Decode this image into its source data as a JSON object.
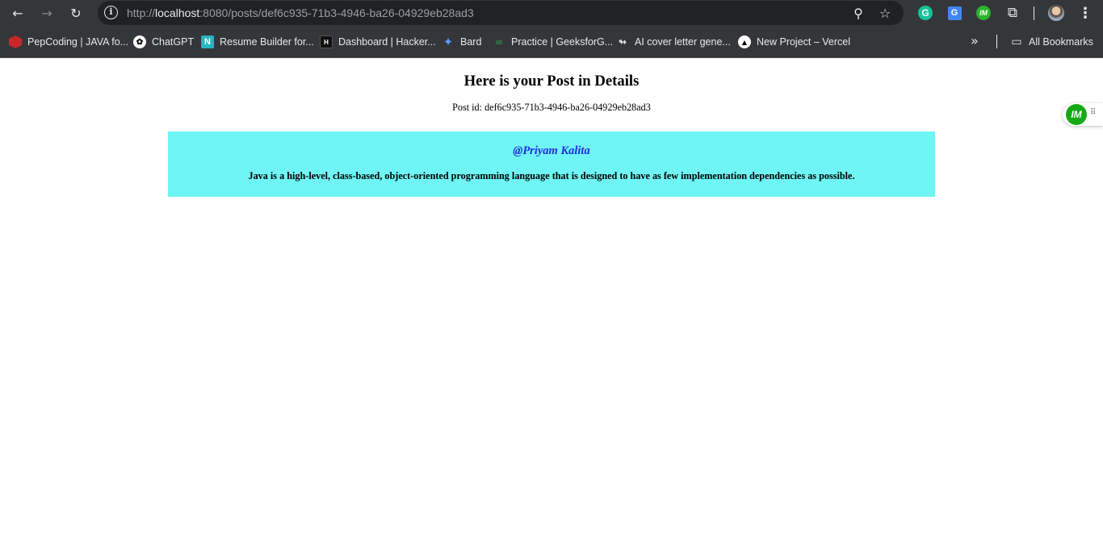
{
  "browser": {
    "url_scheme": "http://",
    "url_host": "localhost",
    "url_path": ":8080/posts/def6c935-71b3-4946-ba26-04929eb28ad3",
    "extensions": [
      "grammarly-icon",
      "google-translate-icon",
      "im-extension-icon",
      "extensions-puzzle-icon"
    ]
  },
  "bookmarks": {
    "items": [
      {
        "label": "PepCoding | JAVA fo...",
        "icon": "pepcoding-icon"
      },
      {
        "label": "ChatGPT",
        "icon": "chatgpt-icon"
      },
      {
        "label": "Resume Builder for...",
        "icon": "resume-builder-icon"
      },
      {
        "label": "Dashboard | Hacker...",
        "icon": "hackerrank-icon"
      },
      {
        "label": "Bard",
        "icon": "bard-icon"
      },
      {
        "label": "Practice | GeeksforG...",
        "icon": "geeksforgeeks-icon"
      },
      {
        "label": "AI cover letter gene...",
        "icon": "ai-cover-letter-icon"
      },
      {
        "label": "New Project – Vercel",
        "icon": "vercel-icon"
      }
    ],
    "all_bookmarks": "All Bookmarks"
  },
  "page": {
    "title": "Here is your Post in Details",
    "post_id_text": "Post id: def6c935-71b3-4946-ba26-04929eb28ad3",
    "post": {
      "author": "@Priyam Kalita",
      "content": "Java is a high-level, class-based, object-oriented programming language that is designed to have as few implementation dependencies as possible."
    }
  },
  "colors": {
    "card_background": "#6ff5f5",
    "author_text": "#1f2de0",
    "chrome_background": "#35363a",
    "omnibox_background": "#202124"
  }
}
